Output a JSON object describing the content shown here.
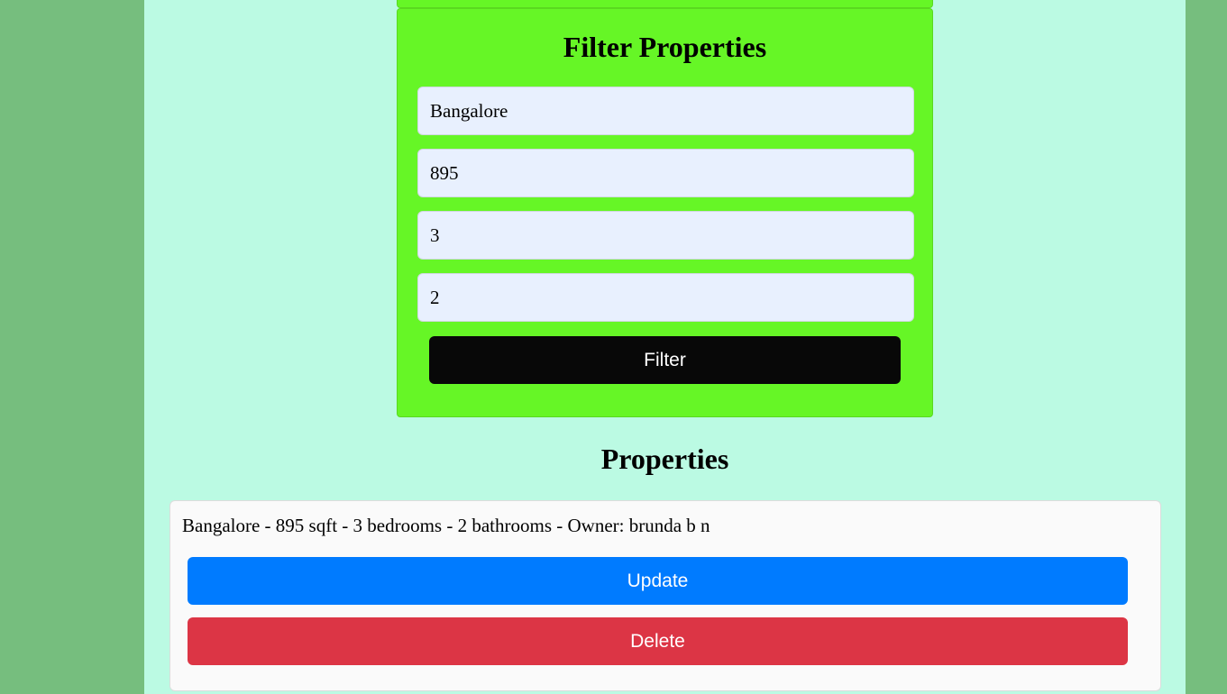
{
  "filter": {
    "title": "Filter Properties",
    "location_value": "Bangalore",
    "area_value": "895",
    "bedrooms_value": "3",
    "bathrooms_value": "2",
    "button_label": "Filter"
  },
  "properties": {
    "title": "Properties",
    "items": [
      {
        "summary": "Bangalore - 895 sqft - 3 bedrooms - 2 bathrooms - Owner: brunda b n",
        "update_label": "Update",
        "delete_label": "Delete"
      }
    ]
  },
  "colors": {
    "page_bg": "#76be7e",
    "content_bg": "#bbfae3",
    "filter_card_bg": "#66f626",
    "filter_button_bg": "#080808",
    "update_button_bg": "#007bff",
    "delete_button_bg": "#dc3545"
  }
}
